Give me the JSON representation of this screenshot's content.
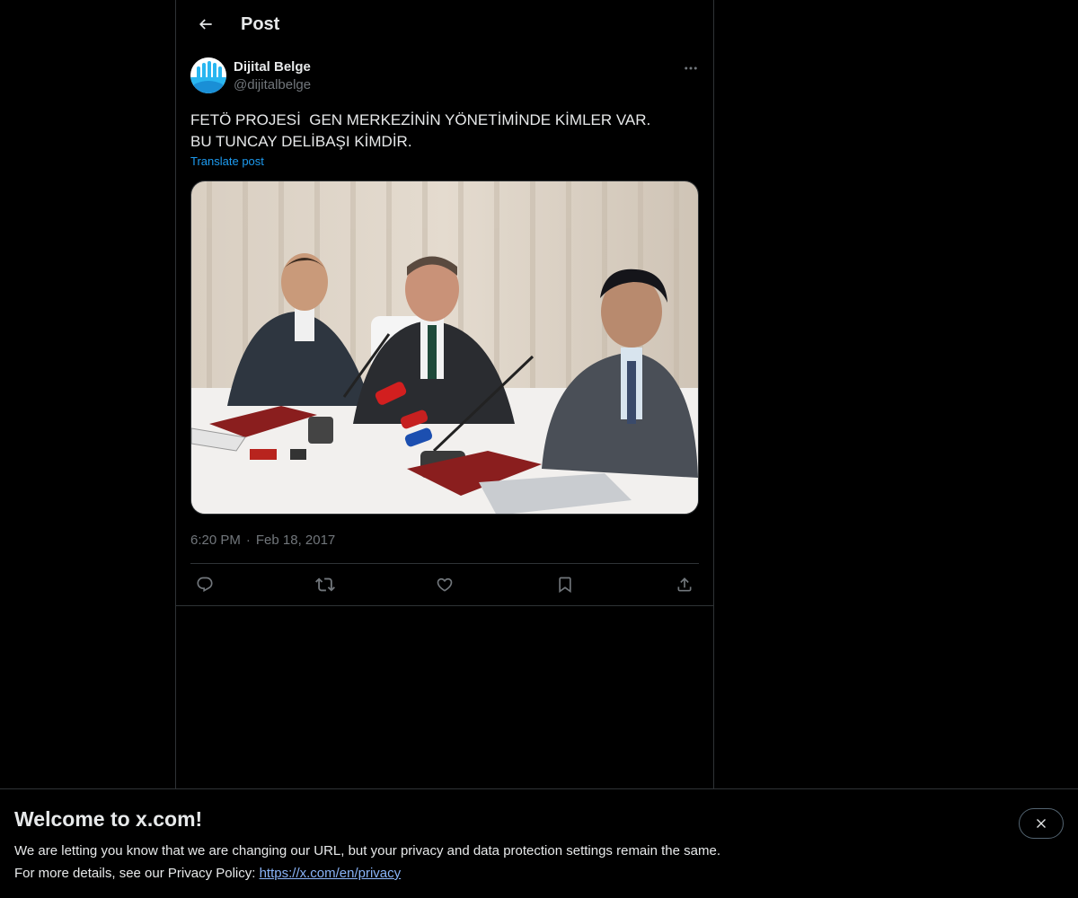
{
  "header": {
    "title": "Post"
  },
  "post": {
    "author": {
      "display_name": "Dijital Belge",
      "handle": "@dijitalbelge"
    },
    "text": "FETÖ PROJESİ  GEN MERKEZİNİN YÖNETİMİNDE KİMLER VAR. BU TUNCAY DELİBAŞI KİMDİR.",
    "translate_label": "Translate post",
    "time": "6:20 PM",
    "separator": "·",
    "date": "Feb 18, 2017"
  },
  "icons": {
    "back": "arrow-left-icon",
    "more": "more-icon",
    "reply": "reply-icon",
    "repost": "repost-icon",
    "like": "like-icon",
    "bookmark": "bookmark-icon",
    "share": "share-icon",
    "close": "close-icon"
  },
  "banner": {
    "title": "Welcome to x.com!",
    "line1": "We are letting you know that we are changing our URL, but your privacy and data protection settings remain the same.",
    "line2_prefix": "For more details, see our Privacy Policy: ",
    "link_text": "https://x.com/en/privacy"
  },
  "colors": {
    "background": "#000000",
    "text": "#e7e9ea",
    "muted": "#71767b",
    "accent": "#1d9bf0",
    "border": "#2f3336",
    "link": "#8ab4f8"
  }
}
